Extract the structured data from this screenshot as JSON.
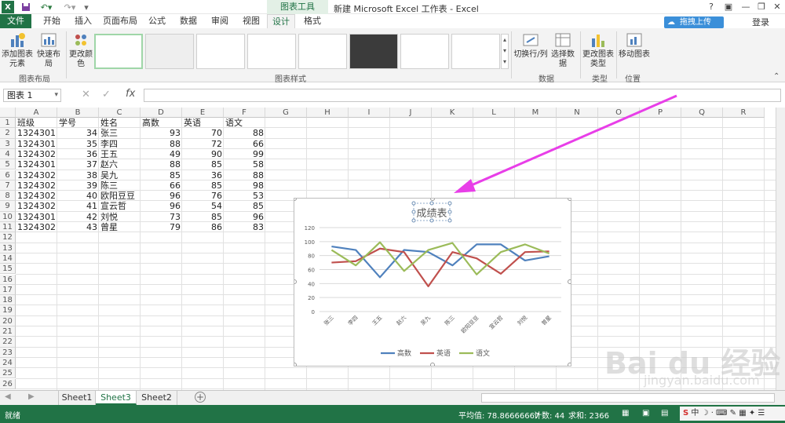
{
  "window": {
    "title": "新建 Microsoft Excel 工作表 - Excel",
    "tools_tag": "图表工具",
    "help": "?",
    "login": "登录",
    "upload_label": "拖拽上传"
  },
  "tabs": [
    "文件",
    "开始",
    "插入",
    "页面布局",
    "公式",
    "数据",
    "审阅",
    "视图",
    "设计",
    "格式"
  ],
  "ribbon": {
    "add_element": "添加图表元素",
    "quick_layout": "快速布局",
    "change_colors": "更改颜色",
    "switch_row_col": "切换行/列",
    "select_data": "选择数据",
    "change_type": "更改图表类型",
    "move_chart": "移动图表",
    "groups": {
      "layout": "图表布局",
      "styles": "图表样式",
      "data": "数据",
      "type": "类型",
      "location": "位置"
    }
  },
  "formula_bar": {
    "name_box": "图表 1",
    "fx": "fx",
    "content": ""
  },
  "columns": [
    "A",
    "B",
    "C",
    "D",
    "E",
    "F",
    "G",
    "H",
    "I",
    "J",
    "K",
    "L",
    "M",
    "N",
    "O",
    "P",
    "Q",
    "R"
  ],
  "rows": [
    "1",
    "2",
    "3",
    "4",
    "5",
    "6",
    "7",
    "8",
    "9",
    "10",
    "11",
    "12",
    "13",
    "14",
    "15",
    "16",
    "17",
    "18",
    "19",
    "20",
    "21",
    "22",
    "23",
    "24",
    "25",
    "26"
  ],
  "table": {
    "headers": [
      "班级",
      "学号",
      "姓名",
      "高数",
      "英语",
      "语文"
    ],
    "data": [
      [
        "1324301",
        "34",
        "张三",
        "93",
        "70",
        "88"
      ],
      [
        "1324301",
        "35",
        "李四",
        "88",
        "72",
        "66"
      ],
      [
        "1324302",
        "36",
        "王五",
        "49",
        "90",
        "99"
      ],
      [
        "1324301",
        "37",
        "赵六",
        "88",
        "85",
        "58"
      ],
      [
        "1324302",
        "38",
        "吴九",
        "85",
        "36",
        "88"
      ],
      [
        "1324302",
        "39",
        "陈三",
        "66",
        "85",
        "98"
      ],
      [
        "1324302",
        "40",
        "欧阳豆豆",
        "96",
        "76",
        "53"
      ],
      [
        "1324302",
        "41",
        "宣云哲",
        "96",
        "54",
        "85"
      ],
      [
        "1324301",
        "42",
        "刘悦",
        "73",
        "85",
        "96"
      ],
      [
        "1324302",
        "43",
        "曾星",
        "79",
        "86",
        "83"
      ]
    ]
  },
  "sheets": [
    "Sheet1",
    "Sheet3",
    "Sheet2"
  ],
  "active_sheet": "Sheet3",
  "status": {
    "ready": "就绪",
    "average": "平均值: 78.86666667",
    "count": "计数: 44",
    "sum": "求和: 2366"
  },
  "chart_data": {
    "type": "line",
    "title": "成绩表",
    "categories": [
      "张三",
      "李四",
      "王五",
      "赵六",
      "吴九",
      "陈三",
      "欧阳豆豆",
      "宣云哲",
      "刘悦",
      "曾星"
    ],
    "series": [
      {
        "name": "高数",
        "values": [
          93,
          88,
          49,
          88,
          85,
          66,
          96,
          96,
          73,
          79
        ],
        "color": "#4f81bd"
      },
      {
        "name": "英语",
        "values": [
          70,
          72,
          90,
          85,
          36,
          85,
          76,
          54,
          85,
          86
        ],
        "color": "#c0504d"
      },
      {
        "name": "语文",
        "values": [
          88,
          66,
          99,
          58,
          88,
          98,
          53,
          85,
          96,
          83
        ],
        "color": "#9bbb59"
      }
    ],
    "y_ticks": [
      "0",
      "20",
      "40",
      "60",
      "80",
      "100",
      "120"
    ],
    "ylim": [
      0,
      120
    ],
    "grid": true,
    "legend": "bottom"
  },
  "watermark": {
    "main": "Bai du 经验",
    "sub": "jingyan.baidu.com"
  }
}
